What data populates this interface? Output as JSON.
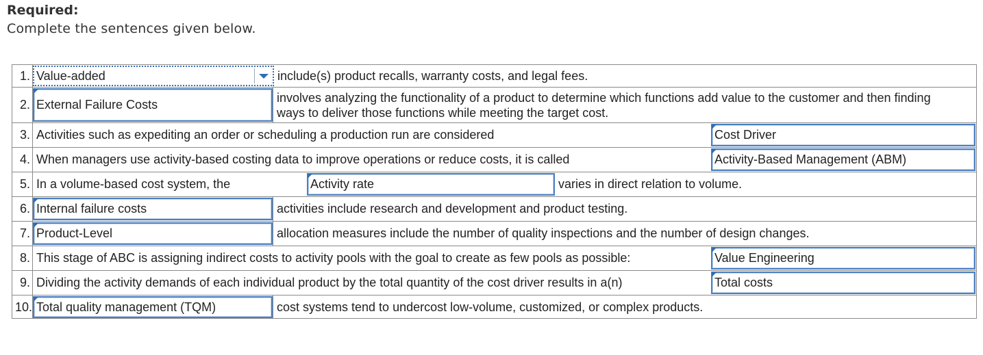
{
  "header": {
    "required_label": "Required:",
    "instruction": "Complete the sentences given below."
  },
  "colors": {
    "accent": "#4a7fc1",
    "flag": "#2f6db5",
    "border": "#8a8a8a"
  },
  "rows": [
    {
      "number": "1.",
      "answer": "Value-added",
      "text_after": "include(s) product recalls, warranty costs, and legal fees."
    },
    {
      "number": "2.",
      "answer": "External Failure Costs",
      "text_after": "involves analyzing the functionality of a product to determine which functions add value to the customer and then finding ways to deliver those functions while meeting the target cost."
    },
    {
      "number": "3.",
      "text_before": "Activities such as expediting an order or scheduling a production run are considered",
      "answer": "Cost Driver"
    },
    {
      "number": "4.",
      "text_before": "When managers use activity-based costing data to improve operations or reduce costs, it is called",
      "answer": "Activity-Based Management (ABM)"
    },
    {
      "number": "5.",
      "text_before": "In a volume-based cost system, the",
      "answer": "Activity rate",
      "text_after": "varies in direct relation to volume."
    },
    {
      "number": "6.",
      "answer": "Internal failure costs",
      "text_after": "activities include research and development and product testing."
    },
    {
      "number": "7.",
      "answer": "Product-Level",
      "text_after": "allocation measures include the number of quality inspections and the number of design changes."
    },
    {
      "number": "8.",
      "text_before": "This stage of ABC is assigning indirect costs to activity pools with the goal to create as few pools as possible:",
      "answer": "Value Engineering"
    },
    {
      "number": "9.",
      "text_before": "Dividing the activity demands of each individual product by the total quantity of the cost driver results in a(n)",
      "answer": "Total costs"
    },
    {
      "number": "10.",
      "answer": "Total quality management (TQM)",
      "text_after": "cost systems tend to undercost low-volume, customized, or complex products."
    }
  ]
}
